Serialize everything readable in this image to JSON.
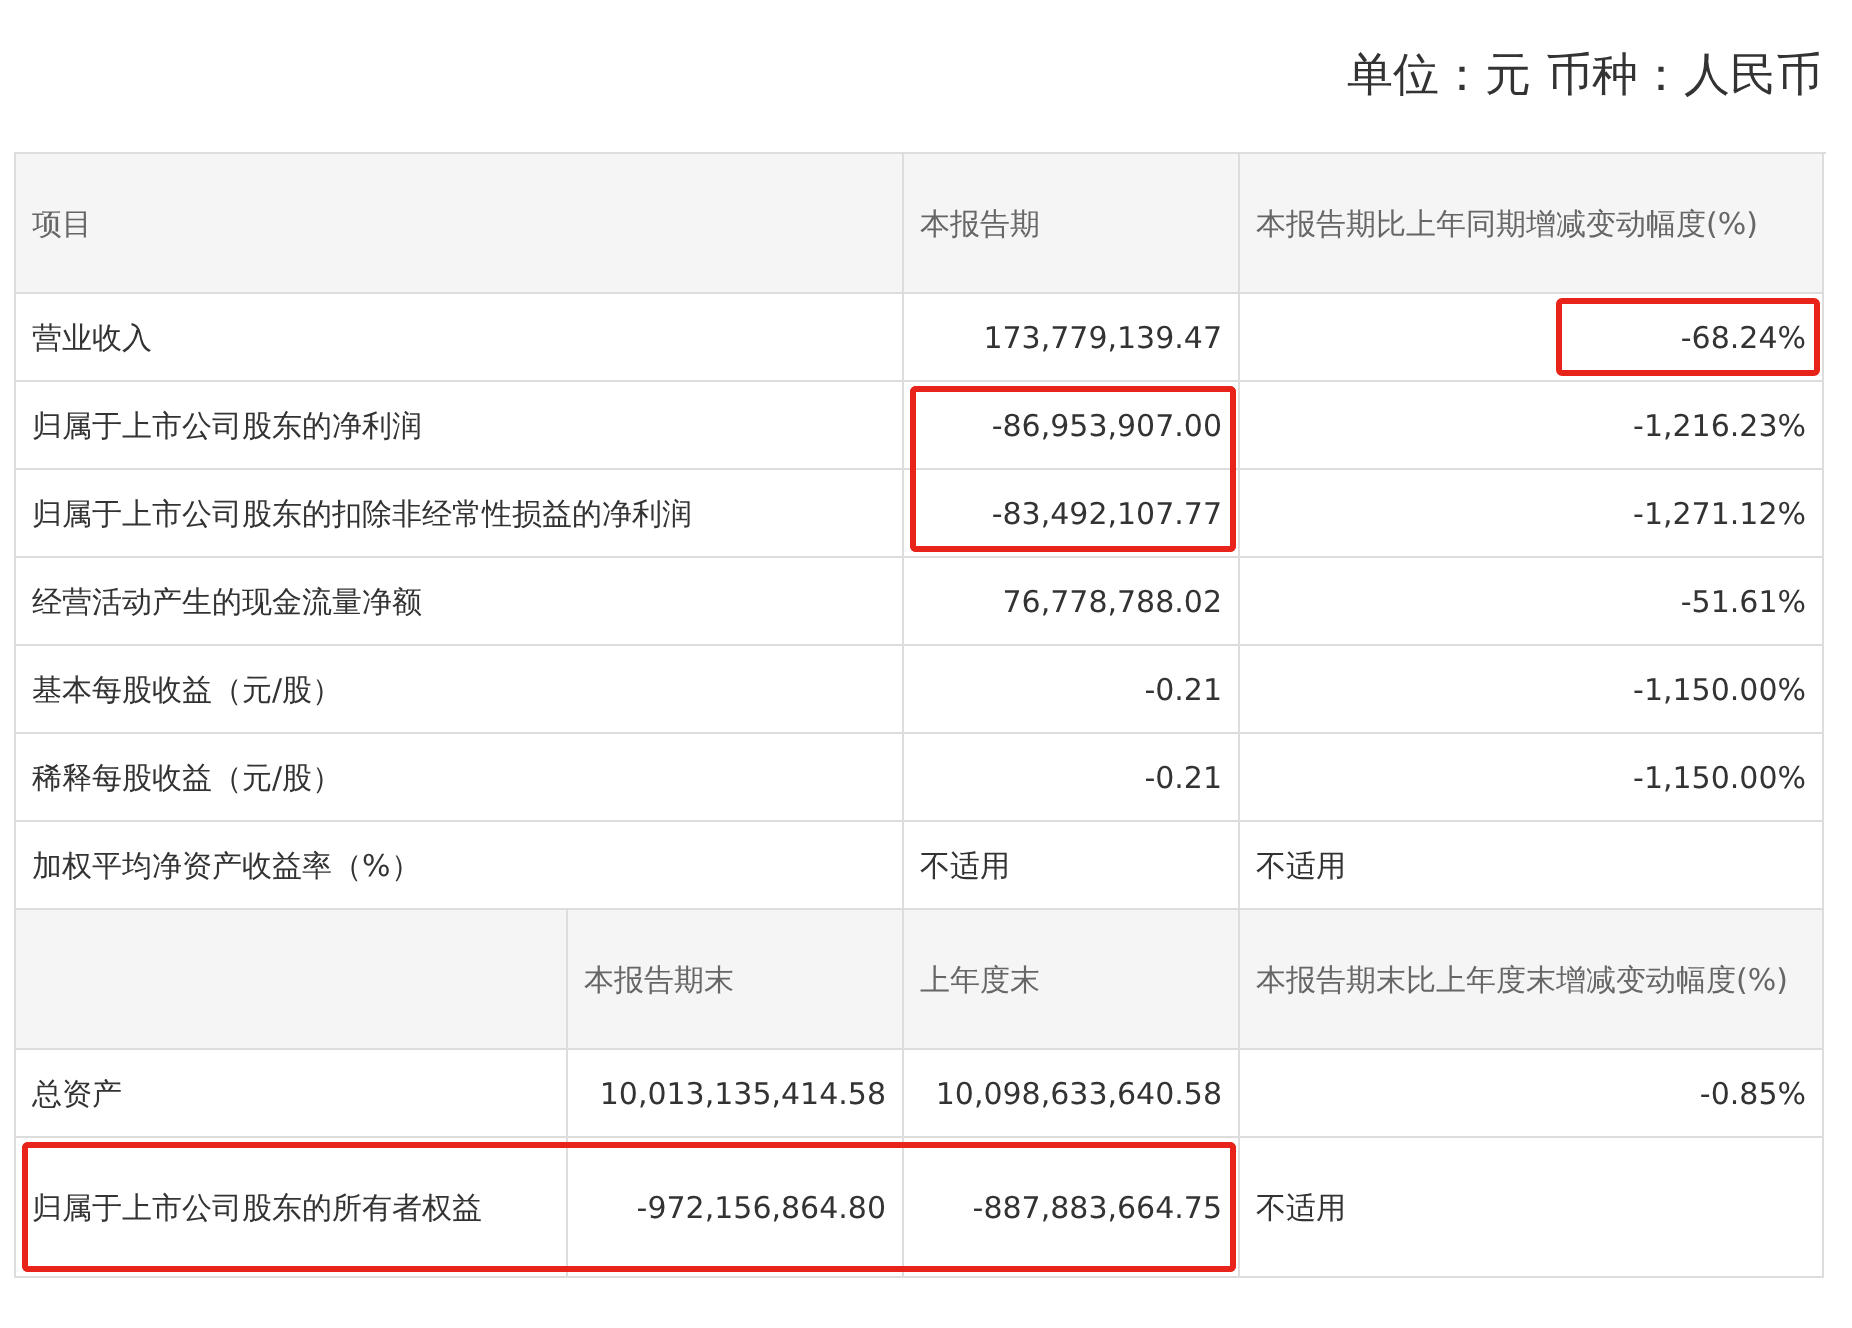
{
  "unit_caption": "单位：元 币种：人民币",
  "summary": {
    "headers": [
      "项目",
      "本报告期",
      "本报告期比上年同期增减变动幅度(%)"
    ],
    "rows": [
      {
        "label": {
          "text": "营业收入"
        },
        "current": {
          "text": "173,779,139.47",
          "kind": "number"
        },
        "change": {
          "text": "-68.24%",
          "kind": "number",
          "highlighted": true
        }
      },
      {
        "label": {
          "text": "归属于上市公司股东的净利润"
        },
        "current": {
          "text": "-86,953,907.00",
          "kind": "number",
          "highlighted": true
        },
        "change": {
          "text": "-1,216.23%",
          "kind": "number"
        }
      },
      {
        "label": {
          "text": "归属于上市公司股东的扣除非经常性损益的净利润"
        },
        "current": {
          "text": "-83,492,107.77",
          "kind": "number",
          "highlighted": true
        },
        "change": {
          "text": "-1,271.12%",
          "kind": "number"
        }
      },
      {
        "label": {
          "text": "经营活动产生的现金流量净额"
        },
        "current": {
          "text": "76,778,788.02",
          "kind": "number"
        },
        "change": {
          "text": "-51.61%",
          "kind": "number"
        }
      },
      {
        "label": {
          "text": "基本每股收益（元/股）"
        },
        "current": {
          "text": "-0.21",
          "kind": "number"
        },
        "change": {
          "text": "-1,150.00%",
          "kind": "number"
        }
      },
      {
        "label": {
          "text": "稀释每股收益（元/股）"
        },
        "current": {
          "text": "-0.21",
          "kind": "number"
        },
        "change": {
          "text": "-1,150.00%",
          "kind": "number"
        }
      },
      {
        "label": {
          "text": "加权平均净资产收益率（%）"
        },
        "current": {
          "text": "不适用",
          "kind": "text"
        },
        "change": {
          "text": "不适用",
          "kind": "text"
        }
      }
    ]
  },
  "balance": {
    "headers": [
      "本报告期末",
      "上年度末",
      "本报告期末比上年度末增减变动幅度(%)"
    ],
    "rows": [
      {
        "label": {
          "text": "总资产"
        },
        "current": {
          "text": "10,013,135,414.58",
          "kind": "number"
        },
        "prior": {
          "text": "10,098,633,640.58",
          "kind": "number"
        },
        "change": {
          "text": "-0.85%",
          "kind": "number"
        }
      },
      {
        "label": {
          "text": "归属于上市公司股东的所有者权益",
          "highlighted": true
        },
        "current": {
          "text": "-972,156,864.80",
          "kind": "number",
          "highlighted": true
        },
        "prior": {
          "text": "-887,883,664.75",
          "kind": "number",
          "highlighted": true
        },
        "change": {
          "text": "不适用",
          "kind": "text"
        }
      }
    ]
  }
}
